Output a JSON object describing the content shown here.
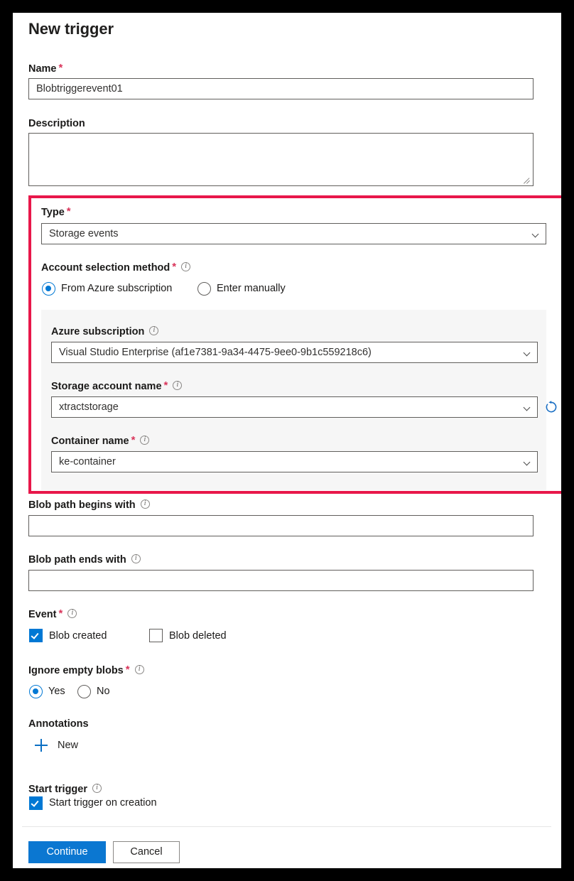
{
  "dialog": {
    "title": "New trigger"
  },
  "fields": {
    "name": {
      "label": "Name",
      "required": true,
      "value": "Blobtriggerevent01"
    },
    "description": {
      "label": "Description",
      "value": ""
    },
    "type": {
      "label": "Type",
      "required": true,
      "value": "Storage events"
    },
    "account_selection_method": {
      "label": "Account selection method",
      "required": true,
      "options": [
        {
          "label": "From Azure subscription",
          "selected": true
        },
        {
          "label": "Enter manually",
          "selected": false
        }
      ]
    },
    "azure_subscription": {
      "label": "Azure subscription",
      "value": "Visual Studio Enterprise (af1e7381-9a34-4475-9ee0-9b1c559218c6)"
    },
    "storage_account_name": {
      "label": "Storage account name",
      "required": true,
      "value": "xtractstorage"
    },
    "container_name": {
      "label": "Container name",
      "required": true,
      "value": "ke-container"
    },
    "blob_path_begins_with": {
      "label": "Blob path begins with",
      "value": ""
    },
    "blob_path_ends_with": {
      "label": "Blob path ends with",
      "value": ""
    },
    "event": {
      "label": "Event",
      "required": true,
      "options": [
        {
          "label": "Blob created",
          "checked": true
        },
        {
          "label": "Blob deleted",
          "checked": false
        }
      ]
    },
    "ignore_empty_blobs": {
      "label": "Ignore empty blobs",
      "required": true,
      "options": [
        {
          "label": "Yes",
          "selected": true
        },
        {
          "label": "No",
          "selected": false
        }
      ]
    },
    "annotations": {
      "label": "Annotations",
      "new_label": "New"
    },
    "start_trigger": {
      "label": "Start trigger",
      "checkbox_label": "Start trigger on creation",
      "checked": true
    }
  },
  "footer": {
    "continue_label": "Continue",
    "cancel_label": "Cancel"
  },
  "icons": {
    "info": "info-icon",
    "chevron": "chevron-down-icon",
    "refresh": "refresh-icon",
    "plus": "plus-icon",
    "resize": "resize-grip-icon"
  },
  "colors": {
    "accent": "#0078d4",
    "primary_button": "#0b77d1",
    "required_asterisk": "#d9345a",
    "highlight_border": "#e8174a",
    "panel_background": "#f6f6f6"
  }
}
